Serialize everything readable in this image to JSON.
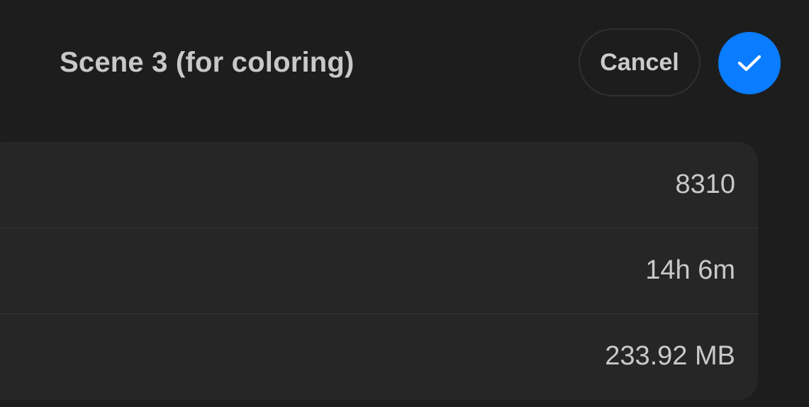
{
  "header": {
    "title": "Scene 3 (for coloring)",
    "cancel_label": "Cancel",
    "confirm_icon": "checkmark-icon"
  },
  "details": {
    "rows": [
      {
        "value": "8310"
      },
      {
        "value": "14h 6m"
      },
      {
        "value": "233.92 MB"
      }
    ]
  },
  "colors": {
    "background": "#1d1d1e",
    "card": "#262627",
    "accent": "#0a7cff",
    "text": "#c9c9c9"
  }
}
